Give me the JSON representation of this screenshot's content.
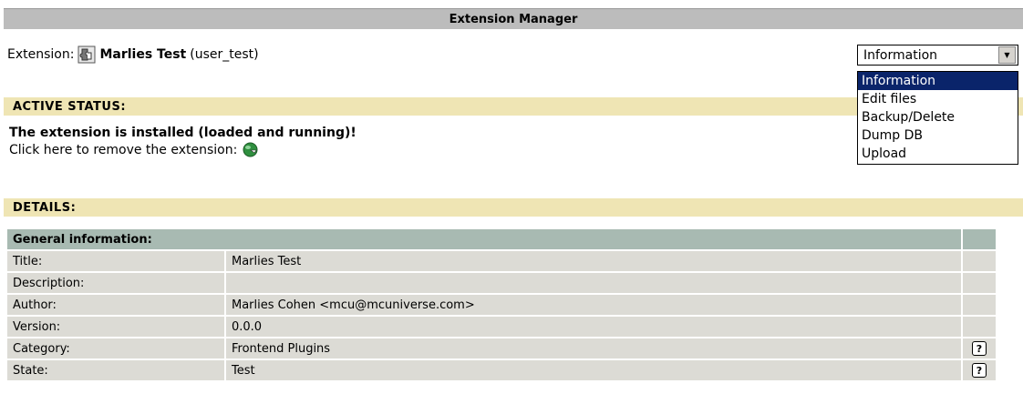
{
  "header": {
    "title": "Extension Manager"
  },
  "extension": {
    "label": "Extension:",
    "icon": "extension-puzzle-icon",
    "name": "Marlies Test",
    "key": "(user_test)"
  },
  "menu": {
    "selected": "Information",
    "options": [
      "Information",
      "Edit files",
      "Backup/Delete",
      "Dump DB",
      "Upload"
    ]
  },
  "active_status": {
    "heading": "ACTIVE STATUS:",
    "message": "The extension is installed (loaded and running)!",
    "remove_text": "Click here to remove the extension:",
    "remove_icon": "remove-extension-icon"
  },
  "details": {
    "heading": "DETAILS:",
    "general_heading": "General information:",
    "rows": [
      {
        "label": "Title:",
        "value": "Marlies Test",
        "help": false
      },
      {
        "label": "Description:",
        "value": "",
        "help": false
      },
      {
        "label": "Author:",
        "value": "Marlies Cohen <mcu@mcuniverse.com>",
        "help": false
      },
      {
        "label": "Version:",
        "value": "0.0.0",
        "help": false
      },
      {
        "label": "Category:",
        "value": "Frontend Plugins",
        "help": true
      },
      {
        "label": "State:",
        "value": "Test",
        "help": true
      }
    ],
    "help_glyph": "?"
  },
  "colors": {
    "header_bg": "#bcbcbc",
    "section_bg": "#efe5b4",
    "general_bg": "#a8bab2",
    "row_bg": "#dcdbd5",
    "selected_bg": "#0a246a"
  }
}
